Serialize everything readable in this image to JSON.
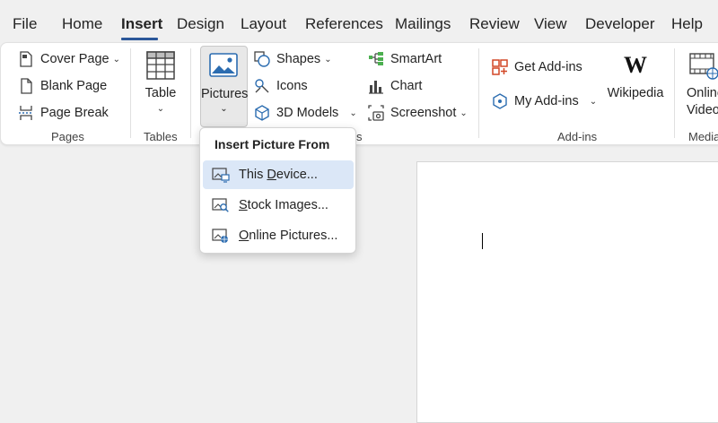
{
  "tabs": [
    "File",
    "Home",
    "Insert",
    "Design",
    "Layout",
    "References",
    "Mailings",
    "Review",
    "View",
    "Developer",
    "Help"
  ],
  "active_tab": "Insert",
  "ribbon": {
    "pages": {
      "cover_page": "Cover Page",
      "blank_page": "Blank Page",
      "page_break": "Page Break",
      "group_label": "Pages"
    },
    "tables": {
      "table": "Table",
      "group_label": "Tables"
    },
    "illustrations": {
      "pictures": "Pictures",
      "shapes": "Shapes",
      "icons": "Icons",
      "models_3d": "3D Models",
      "smartart": "SmartArt",
      "chart": "Chart",
      "screenshot": "Screenshot",
      "group_label_tail": "s"
    },
    "addins": {
      "get_addins": "Get Add-ins",
      "my_addins": "My Add-ins",
      "wikipedia": "Wikipedia",
      "group_label": "Add-ins"
    },
    "media": {
      "online_video_1": "Online",
      "online_video_2": "Video",
      "group_label": "Media"
    }
  },
  "pictures_menu": {
    "header": "Insert Picture From",
    "items": [
      {
        "pre": "This ",
        "key": "D",
        "post": "evice..."
      },
      {
        "pre": "",
        "key": "S",
        "post": "tock Images..."
      },
      {
        "pre": "",
        "key": "O",
        "post": "nline Pictures..."
      }
    ]
  },
  "colors": {
    "accent": "#2b579a",
    "hover": "#dbe7f7",
    "ribbon_bg": "#ffffff",
    "app_bg": "#f0f0f0",
    "addin_orange": "#d24726",
    "icon_blue": "#2b6cb0"
  }
}
